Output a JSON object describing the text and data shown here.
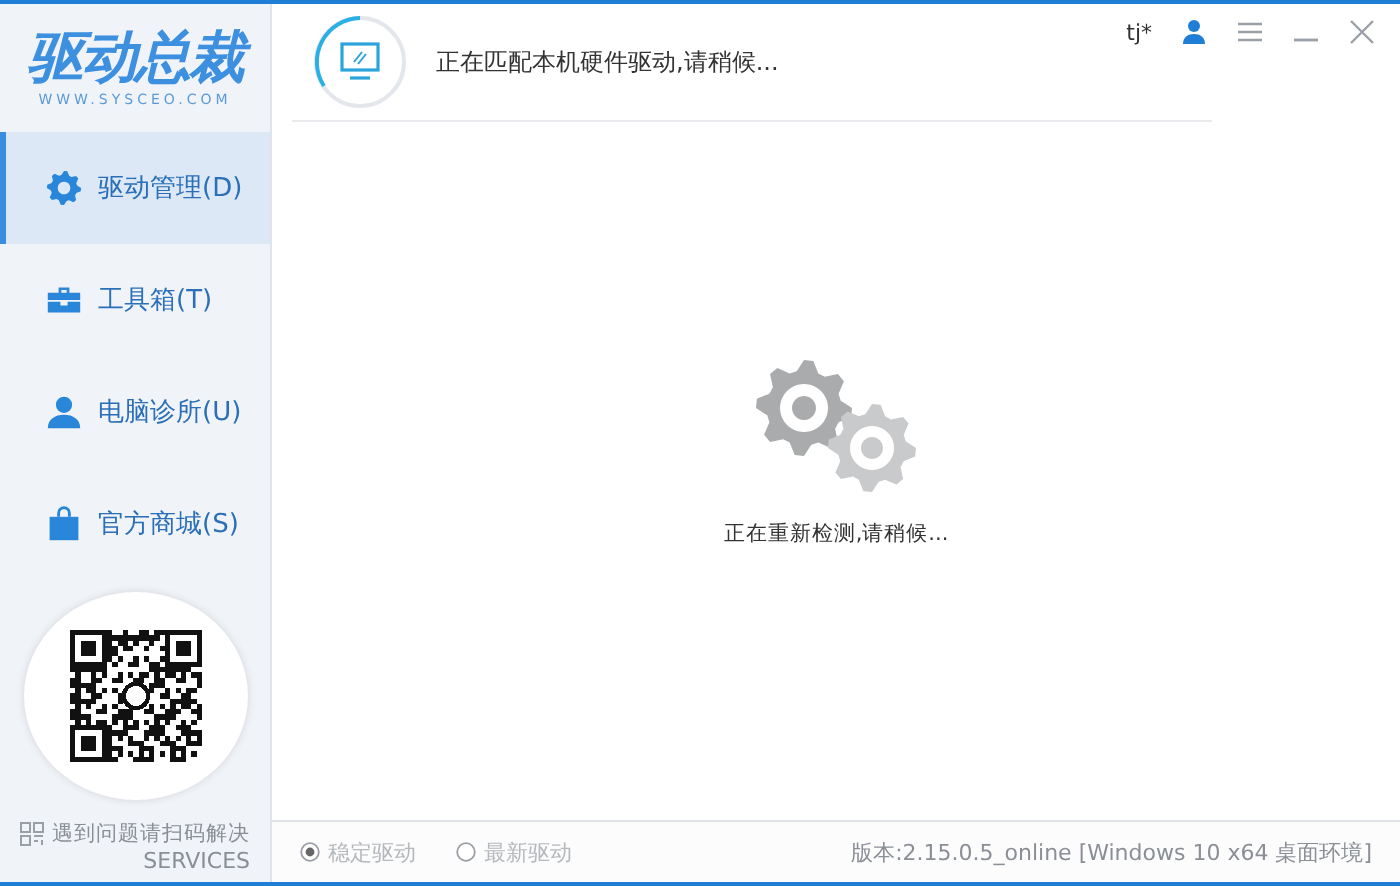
{
  "logo": {
    "title": "驱动总裁",
    "subtitle": "WWW.SYSCEO.COM"
  },
  "sidebar": {
    "items": [
      {
        "kind": "gear",
        "label": "驱动管理(D)",
        "selected": true
      },
      {
        "kind": "toolbox",
        "label": "工具箱(T)",
        "selected": false
      },
      {
        "kind": "person",
        "label": "电脑诊所(U)",
        "selected": false
      },
      {
        "kind": "bag",
        "label": "官方商城(S)",
        "selected": false
      }
    ]
  },
  "services": {
    "label": "遇到问题请扫码解决",
    "caption": "SERVICES"
  },
  "titlebar": {
    "user": "tj*"
  },
  "header": {
    "status": "正在匹配本机硬件驱动,请稍候..."
  },
  "main": {
    "message": "正在重新检测,请稍候..."
  },
  "footer": {
    "options": [
      {
        "label": "稳定驱动",
        "selected": true,
        "disabled": true
      },
      {
        "label": "最新驱动",
        "selected": false,
        "disabled": true
      }
    ],
    "version": "版本:2.15.0.5_online [Windows 10 x64 桌面环境]"
  }
}
